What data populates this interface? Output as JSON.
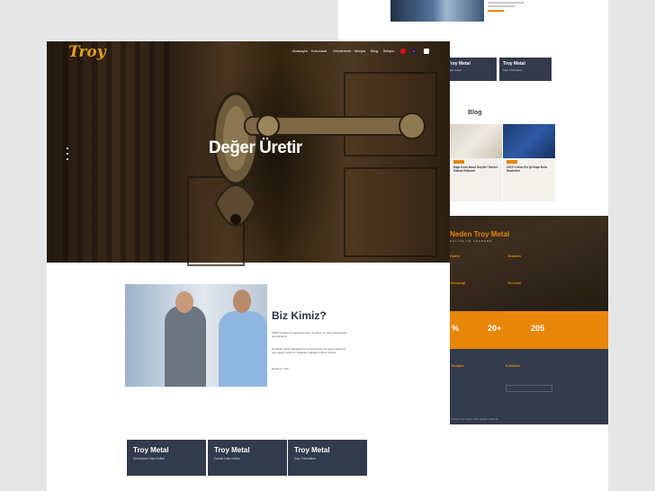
{
  "site": {
    "logo": "Troy"
  },
  "nav": {
    "items": [
      "Anasayfa",
      "Kurumsal",
      "Ürünlerimiz",
      "Medya",
      "Blog",
      "İletişim"
    ]
  },
  "hero": {
    "title": "Değer Üretir"
  },
  "about": {
    "title": "Biz Kimiz?",
    "paragraph1": "1998 Yılından bu yana kapı kolu, donanım ve kapı aksesuarları üretmekteyiz.",
    "paragraph2": "El sıkılık, üretim kapasitemiz ve tecrübemiz ile yapıp yaşamak hep yaşam tarzımız. Sizlerden aldığımız ilham üzerek.",
    "more": "Devamını Oku"
  },
  "cards": [
    {
      "title": "Troy Metal",
      "subtitle": "Alüminyum Kapı Kolları"
    },
    {
      "title": "Troy Metal",
      "subtitle": "Zamak Kapı Kolları"
    },
    {
      "title": "Troy Metal",
      "subtitle": "Kapı Tokmakları"
    }
  ],
  "back": {
    "cards": [
      {
        "title": "Troy Metal",
        "subtitle": "Kapı Kolları"
      },
      {
        "title": "Troy Metal",
        "subtitle": "Kapı Tokmakları"
      }
    ],
    "blog_title": "Blog",
    "blog_posts": [
      {
        "headline": "Kapı Kolu Nasıl Seçilir? Nelere Dikkat Edilmeli"
      },
      {
        "headline": "2019 Yılının En İyi Kapı Kolu Modelleri"
      }
    ],
    "why_title": "Neden Troy Metal",
    "why_sub": "KALİTE VE TECRÜBE",
    "features": [
      "Kalite",
      "Tasarım",
      "Teknoloji",
      "Tecrübe"
    ],
    "stats": [
      "%",
      "20+",
      "205"
    ],
    "footer_titles": [
      "İletişim",
      "E-Bülten"
    ],
    "copyright": "© 2019 Troy Metal. Tüm Hakları Saklıdır."
  },
  "colors": {
    "accent": "#e8860a",
    "dark": "#323a4c"
  }
}
